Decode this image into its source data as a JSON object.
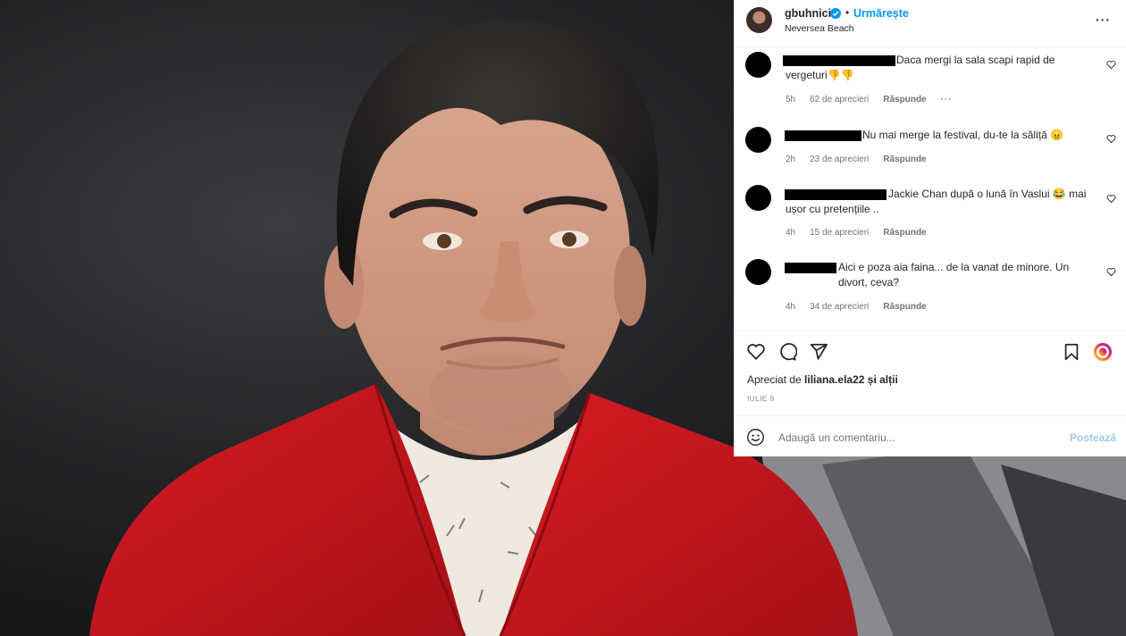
{
  "post": {
    "username": "gbuhnici",
    "follow_label": "Urmărește",
    "separator": "•",
    "location": "Neversea Beach",
    "more_label": "···"
  },
  "comments": [
    {
      "text_line1": "Daca mergi la sala scapi rapid de",
      "text_line2": "vergeturi👎👎",
      "time": "5h",
      "likes": "62 de aprecieri",
      "reply": "Răspunde",
      "options": "···"
    },
    {
      "text_line1": "Nu mai merge la festival, du-te la săliță 😠",
      "time": "2h",
      "likes": "23 de aprecieri",
      "reply": "Răspunde"
    },
    {
      "text_line1": "Jackie Chan după o lună în Vaslui 😂 mai",
      "text_line2": "ușor cu pretențiile ..",
      "time": "4h",
      "likes": "15 de aprecieri",
      "reply": "Răspunde"
    },
    {
      "text_line1": "Aici e poza aia faina... de la vanat de minore. Un",
      "text_line2": "divort, ceva?",
      "time": "4h",
      "likes": "34 de aprecieri",
      "reply": "Răspunde"
    }
  ],
  "likes_line": {
    "prefix": "Apreciat de",
    "user": "liliana.ela22",
    "suffix": "și alții"
  },
  "date": "IULIE 9",
  "add_comment": {
    "placeholder": "Adaugă un comentariu...",
    "post_label": "Postează"
  },
  "colors": {
    "link_blue": "#0095f6",
    "post_disabled": "#9ec9f3",
    "sweater_red": "#c4161c"
  },
  "icons": [
    "verified-badge-icon",
    "more-options-icon",
    "heart-icon",
    "comment-icon",
    "share-icon",
    "bookmark-icon",
    "reels-icon",
    "emoji-icon"
  ]
}
